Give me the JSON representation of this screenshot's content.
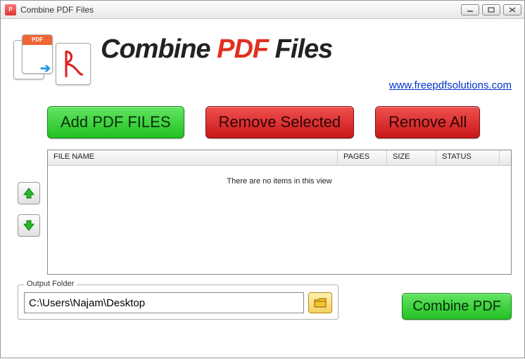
{
  "window": {
    "title": "Combine PDF Files"
  },
  "header": {
    "title_pre": "Combine ",
    "title_accent": "PDF",
    "title_post": " Files",
    "link": "www.freepdfsolutions.com"
  },
  "buttons": {
    "add": "Add PDF FILES",
    "remove_selected": "Remove Selected",
    "remove_all": "Remove All",
    "combine": "Combine PDF"
  },
  "list": {
    "columns": {
      "name": "FILE NAME",
      "pages": "PAGES",
      "size": "SIZE",
      "status": "STATUS"
    },
    "empty": "There are no items in this view",
    "rows": []
  },
  "output": {
    "legend": "Output Folder",
    "path": "C:\\Users\\Najam\\Desktop"
  }
}
